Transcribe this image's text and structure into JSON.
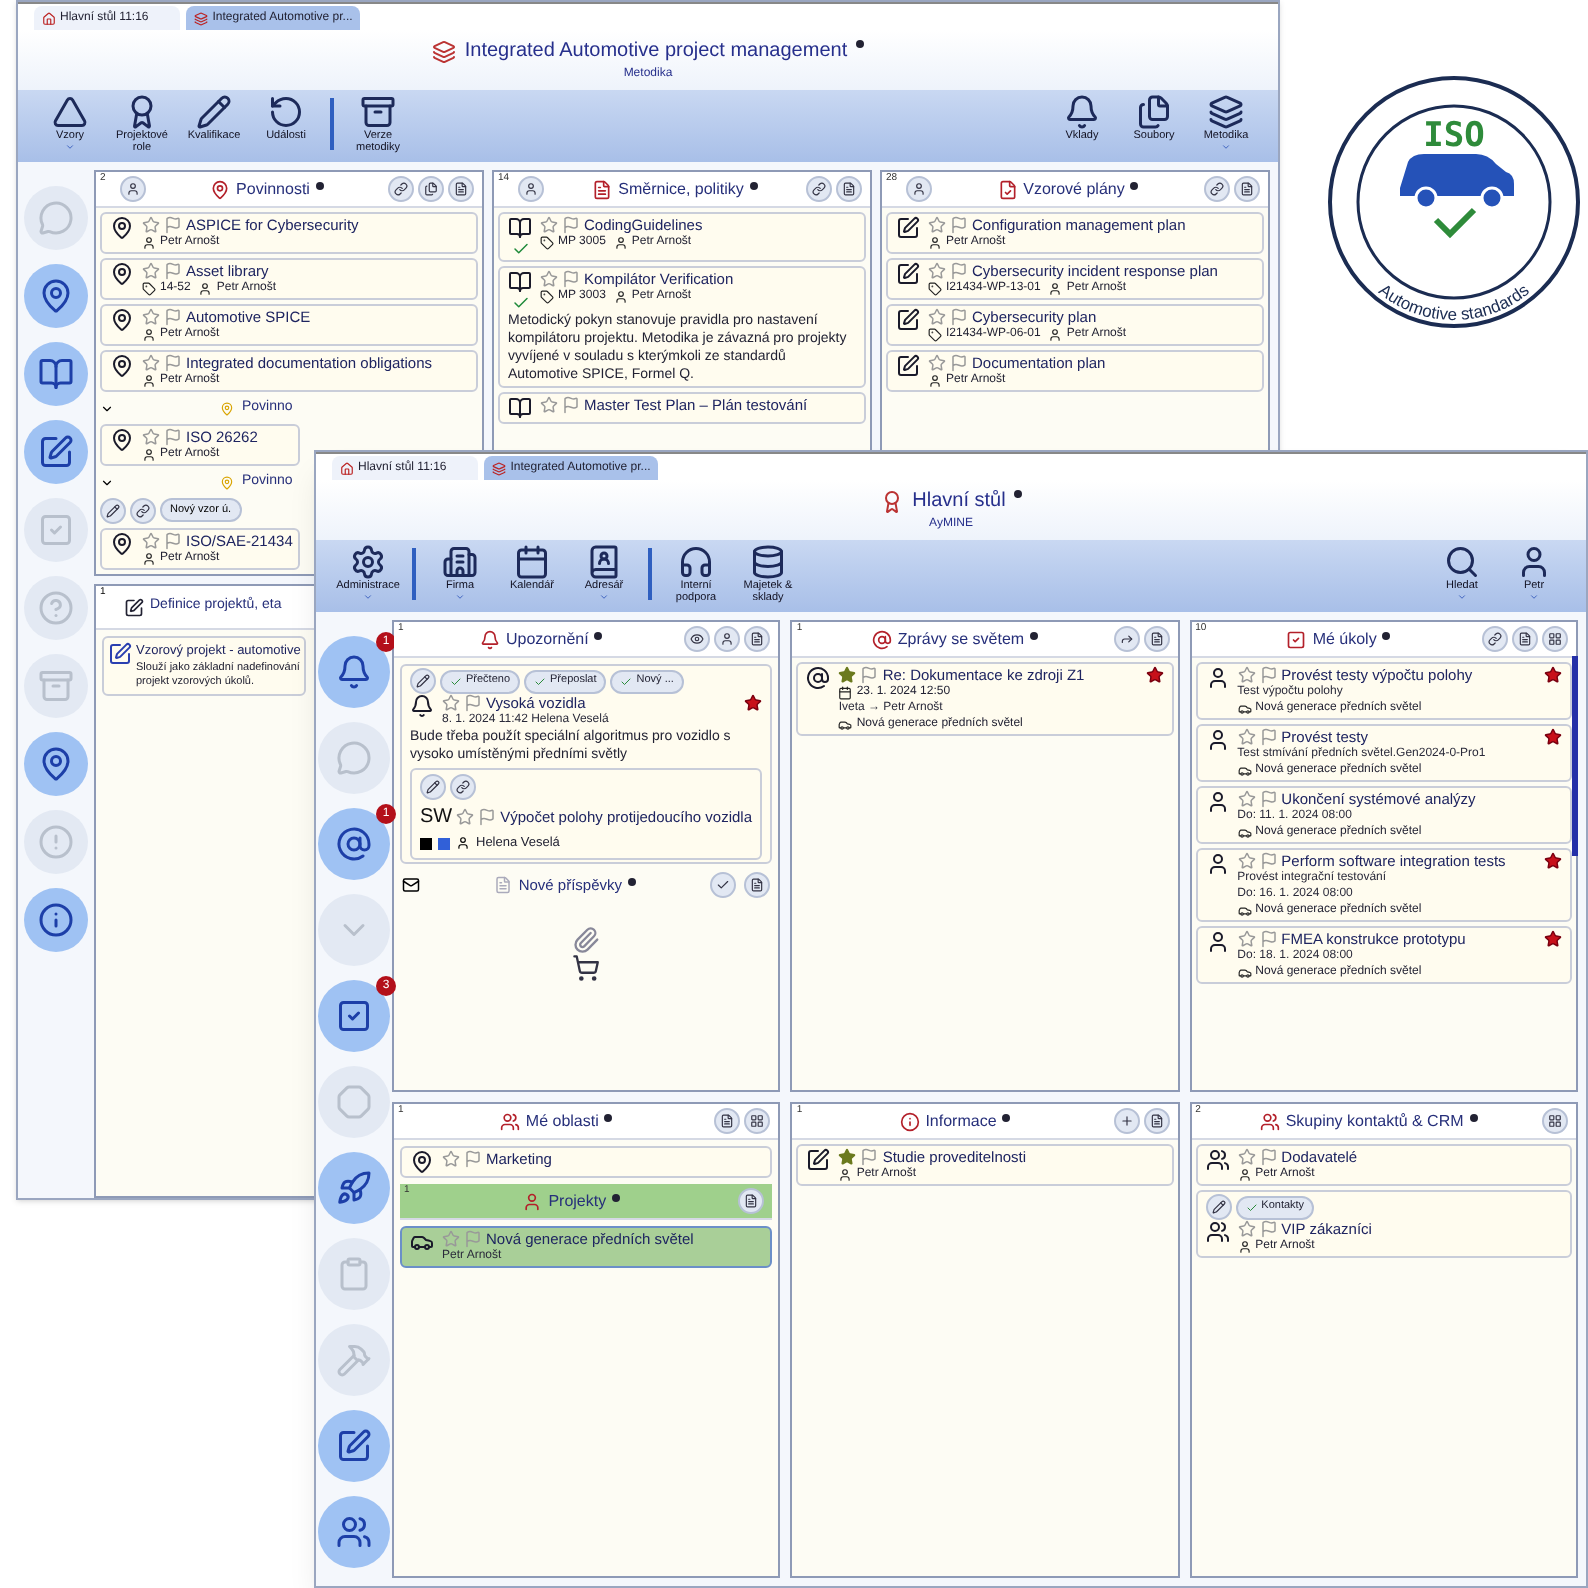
{
  "back_window": {
    "tabs": [
      {
        "label": "Hlavní stůl 11:16"
      },
      {
        "label": "Integrated Automotive pr..."
      }
    ],
    "title": "Integrated Automotive project management",
    "subtitle": "Metodika",
    "toolbar": [
      [
        {
          "label": "Vzory",
          "dropdown": true
        },
        {
          "label": "Projektové role",
          "dropdown": false
        },
        {
          "label": "Kvalifikace",
          "dropdown": false
        },
        {
          "label": "Události",
          "dropdown": false
        }
      ],
      [
        {
          "label": "Verze metodiky",
          "dropdown": false
        }
      ]
    ],
    "toolbar_right": [
      {
        "label": "Vklady",
        "dropdown": false
      },
      {
        "label": "Soubory",
        "dropdown": false
      },
      {
        "label": "Metodika",
        "dropdown": true
      }
    ],
    "sidebar": [
      {
        "active": false
      },
      {
        "active": true
      },
      {
        "active": true
      },
      {
        "active": true
      },
      {
        "active": false
      },
      {
        "active": false
      },
      {
        "active": false
      },
      {
        "active": true
      },
      {
        "active": false
      },
      {
        "active": true
      }
    ],
    "duties": {
      "count": "2",
      "title": "Povinnosti",
      "items": [
        {
          "title": "ASPICE for Cybersecurity",
          "starred": false,
          "lines": [
            [
              {
                "kind": "person",
                "text": "Petr Arnošt"
              }
            ]
          ]
        },
        {
          "title": "Asset library",
          "starred": false,
          "lines": [
            [
              {
                "kind": "code",
                "text": "14-52"
              },
              {
                "kind": "person",
                "text": "Petr Arnošt"
              }
            ]
          ]
        },
        {
          "title": "Automotive SPICE",
          "starred": false,
          "lines": [
            [
              {
                "kind": "person",
                "text": "Petr Arnošt"
              }
            ]
          ]
        },
        {
          "title": "Integrated documentation obligations",
          "starred": false,
          "lines": [
            [
              {
                "kind": "person",
                "text": "Petr Arnošt"
              }
            ]
          ]
        }
      ],
      "groups": [
        {
          "label": "Povinno",
          "items": [
            {
              "title": "ISO 26262",
              "starred": false,
              "lines": [
                [
                  {
                    "kind": "person",
                    "text": "Petr Arnošt"
                  }
                ]
              ]
            }
          ]
        },
        {
          "label": "Povinno",
          "actions": [
            "Nový vzor ú."
          ],
          "items": [
            {
              "title": "ISO/SAE-21434",
              "starred": false,
              "lines": [
                [
                  {
                    "kind": "person",
                    "text": "Petr Arnošt"
                  }
                ]
              ]
            }
          ]
        }
      ]
    },
    "project_definitions": {
      "count": "1",
      "title": "Definice projektů, eta",
      "items": [
        {
          "title": "Vzorový projekt - automotive",
          "desc": "Slouží jako základní nadefinování projekt vzorových úkolů."
        }
      ]
    },
    "guidelines": {
      "count": "14",
      "title": "Směrnice, politiky",
      "items": [
        {
          "title": "CodingGuidelines",
          "starred": false,
          "approved": true,
          "lines": [
            [
              {
                "kind": "code",
                "text": "MP 3005"
              },
              {
                "kind": "person",
                "text": "Petr Arnošt"
              }
            ]
          ]
        },
        {
          "title": "Kompilátor Verification",
          "starred": false,
          "approved": true,
          "lines": [
            [
              {
                "kind": "code",
                "text": "MP 3003"
              },
              {
                "kind": "person",
                "text": "Petr Arnošt"
              }
            ]
          ],
          "desc": "Metodický pokyn stanovuje pravidla pro nastavení kompilátoru projektu. Metodika je závazná pro projekty vyvíjené v souladu s kterýmkoli ze standardů Automotive SPICE, Formel Q."
        },
        {
          "title": "Master Test Plan – Plán testování",
          "starred": false
        }
      ]
    },
    "plans": {
      "count": "28",
      "title": "Vzorové plány",
      "items": [
        {
          "title": "Configuration management plan",
          "starred": false,
          "lines": [
            [
              {
                "kind": "person",
                "text": "Petr Arnošt"
              }
            ]
          ]
        },
        {
          "title": "Cybersecurity incident response plan",
          "starred": false,
          "lines": [
            [
              {
                "kind": "code",
                "text": "I21434-WP-13-01"
              },
              {
                "kind": "person",
                "text": "Petr Arnošt"
              }
            ]
          ]
        },
        {
          "title": "Cybersecurity plan",
          "starred": false,
          "lines": [
            [
              {
                "kind": "code",
                "text": "I21434-WP-06-01"
              },
              {
                "kind": "person",
                "text": "Petr Arnošt"
              }
            ]
          ]
        },
        {
          "title": "Documentation plan",
          "starred": false,
          "lines": [
            [
              {
                "kind": "person",
                "text": "Petr Arnošt"
              }
            ]
          ]
        }
      ]
    }
  },
  "front_window": {
    "tabs": [
      {
        "label": "Hlavní stůl 11:16"
      },
      {
        "label": "Integrated Automotive pr..."
      }
    ],
    "title": "Hlavní stůl",
    "subtitle": "AyMINE",
    "toolbar": [
      [
        {
          "label": "Administrace",
          "dropdown": true
        }
      ],
      [
        {
          "label": "Firma",
          "dropdown": true
        },
        {
          "label": "Kalendář",
          "dropdown": false
        },
        {
          "label": "Adresář",
          "dropdown": true
        }
      ],
      [
        {
          "label": "Interní podpora",
          "dropdown": false
        },
        {
          "label": "Majetek & sklady",
          "dropdown": false
        }
      ]
    ],
    "toolbar_right": [
      {
        "label": "Hledat",
        "dropdown": true
      },
      {
        "label": "Petr",
        "dropdown": true
      }
    ],
    "sidebar": [
      {
        "active": true,
        "badge": "1"
      },
      {
        "active": false
      },
      {
        "active": true,
        "badge": "1"
      },
      {
        "active": false
      },
      {
        "active": true,
        "badge": "3"
      },
      {
        "active": false
      },
      {
        "active": true
      },
      {
        "active": false
      },
      {
        "active": false
      },
      {
        "active": true
      },
      {
        "active": true
      }
    ],
    "alerts": {
      "count": "1",
      "title": "Upozornění",
      "items": [
        {
          "title": "Vysoká vozidla",
          "starred": false,
          "important": true,
          "actions": [
            "Přečteno",
            "Přeposlat",
            "Nový ..."
          ],
          "lines": [
            [
              {
                "kind": "note",
                "text": "8. 1. 2024 11:42 Helena Veselá"
              }
            ]
          ],
          "desc": "Bude třeba použít speciální algoritmus pro vozidlo s vysoko umístěnými předními světly",
          "subitem": {
            "prefix": "SW",
            "title": "Výpočet polohy protijedoucího vozidla",
            "starred": false,
            "person": "Helena Veselá"
          }
        }
      ],
      "new_posts": {
        "title": "Nové příspěvky"
      }
    },
    "messages": {
      "count": "1",
      "title": "Zprávy se světem",
      "items": [
        {
          "title": "Re: Dokumentace ke zdroji Z1",
          "starred": true,
          "important": true,
          "lines": [
            [
              {
                "kind": "date",
                "text": "23. 1. 2024 12:50"
              }
            ],
            [
              {
                "kind": "note",
                "text": "Iveta → Petr Arnošt"
              }
            ],
            [
              {
                "kind": "project",
                "text": "Nová generace předních světel"
              }
            ]
          ]
        }
      ]
    },
    "tasks": {
      "count": "10",
      "title": "Mé úkoly",
      "items": [
        {
          "title": "Provést testy výpočtu polohy",
          "starred": false,
          "important": true,
          "lines": [
            [
              {
                "kind": "note",
                "text": "Test výpočtu polohy"
              }
            ],
            [
              {
                "kind": "project",
                "text": "Nová generace předních světel"
              }
            ]
          ]
        },
        {
          "title": "Provést testy",
          "starred": false,
          "important": true,
          "lines": [
            [
              {
                "kind": "note",
                "text": "Test stmívání předních světel.Gen2024-0-Pro1"
              }
            ],
            [
              {
                "kind": "project",
                "text": "Nová generace předních světel"
              }
            ]
          ]
        },
        {
          "title": "Ukončení systémové analýzy",
          "starred": false,
          "important": false,
          "lines": [
            [
              {
                "kind": "note",
                "text": "Do: 11. 1. 2024 08:00"
              }
            ],
            [
              {
                "kind": "project",
                "text": "Nová generace předních světel"
              }
            ]
          ]
        },
        {
          "title": "Perform software integration tests",
          "starred": false,
          "important": true,
          "lines": [
            [
              {
                "kind": "note",
                "text": "Provést integrační testování"
              }
            ],
            [
              {
                "kind": "note",
                "text": "Do: 16. 1. 2024 08:00"
              }
            ],
            [
              {
                "kind": "project",
                "text": "Nová generace předních světel"
              }
            ]
          ]
        },
        {
          "title": "FMEA konstrukce prototypu",
          "starred": false,
          "important": true,
          "lines": [
            [
              {
                "kind": "note",
                "text": "Do: 18. 1. 2024 08:00"
              }
            ],
            [
              {
                "kind": "project",
                "text": "Nová generace předních světel"
              }
            ]
          ]
        }
      ]
    },
    "areas": {
      "count": "1",
      "title": "Mé oblasti",
      "items": [
        {
          "title": "Marketing",
          "starred": false
        }
      ],
      "projects": {
        "count": "1",
        "title": "Projekty",
        "items": [
          {
            "title": "Nová generace předních světel",
            "starred": false,
            "lines": [
              [
                {
                  "kind": "note",
                  "text": "Petr Arnošt"
                }
              ]
            ]
          }
        ]
      }
    },
    "info": {
      "count": "1",
      "title": "Informace",
      "items": [
        {
          "title": "Studie proveditelnosti",
          "starred": true,
          "lines": [
            [
              {
                "kind": "person",
                "text": "Petr Arnošt"
              }
            ]
          ]
        }
      ]
    },
    "contacts": {
      "count": "2",
      "title": "Skupiny kontaktů & CRM",
      "items": [
        {
          "title": "Dodavatelé",
          "starred": false,
          "lines": [
            [
              {
                "kind": "person",
                "text": "Petr Arnošt"
              }
            ]
          ]
        },
        {
          "title": "VIP zákazníci",
          "starred": false,
          "actions": [
            "Kontakty"
          ],
          "lines": [
            [
              {
                "kind": "person",
                "text": "Petr Arnošt"
              }
            ]
          ]
        }
      ]
    }
  },
  "logo": {
    "title": "ISO",
    "caption": "Automotive standards"
  }
}
